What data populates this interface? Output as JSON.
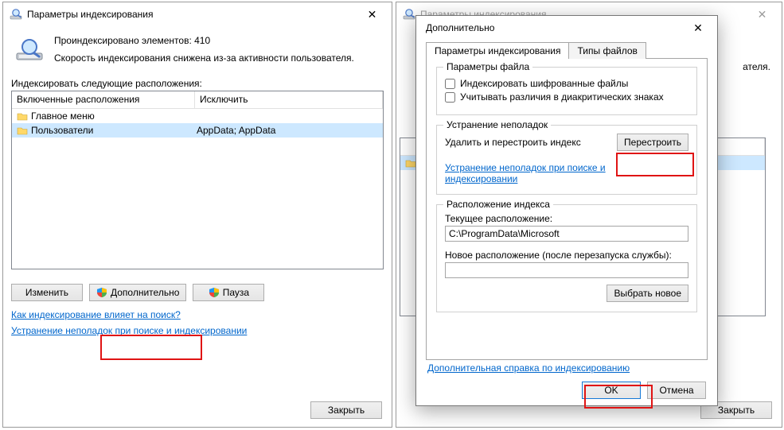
{
  "left": {
    "title": "Параметры индексирования",
    "indexed_line": "Проиндексировано элементов: 410",
    "speed_line": "Скорость индексирования снижена из-за активности пользователя.",
    "locations_label": "Индексировать следующие расположения:",
    "columns": {
      "included": "Включенные расположения",
      "excluded": "Исключить"
    },
    "rows": [
      {
        "name": "Главное меню",
        "excluded": ""
      },
      {
        "name": "Пользователи",
        "excluded": "AppData; AppData"
      }
    ],
    "buttons": {
      "modify": "Изменить",
      "advanced": "Дополнительно",
      "pause": "Пауза",
      "close": "Закрыть"
    },
    "links": {
      "how_affects": "Как индексирование влияет на поиск?",
      "troubleshoot": "Устранение неполадок при поиске и индексировании"
    }
  },
  "right_bg": {
    "title": "Параметры индексирования",
    "speed_line_tail": "ателя.",
    "close": "Закрыть"
  },
  "modal": {
    "title": "Дополнительно",
    "tabs": {
      "indexing": "Параметры индексирования",
      "filetypes": "Типы файлов"
    },
    "group_file": {
      "legend": "Параметры файла",
      "chk_encrypted": "Индексировать шифрованные файлы",
      "chk_diacritics": "Учитывать различия в диакритических знаках"
    },
    "group_trouble": {
      "legend": "Устранение неполадок",
      "desc": "Удалить и перестроить индекс",
      "rebuild_btn": "Перестроить",
      "link": "Устранение неполадок при поиске и индексировании"
    },
    "group_location": {
      "legend": "Расположение индекса",
      "current_label": "Текущее расположение:",
      "current_value": "C:\\ProgramData\\Microsoft",
      "new_label": "Новое расположение (после перезапуска службы):",
      "new_value": "",
      "choose_btn": "Выбрать новое"
    },
    "help_link": "Дополнительная справка по индексированию",
    "ok": "OK",
    "cancel": "Отмена"
  }
}
